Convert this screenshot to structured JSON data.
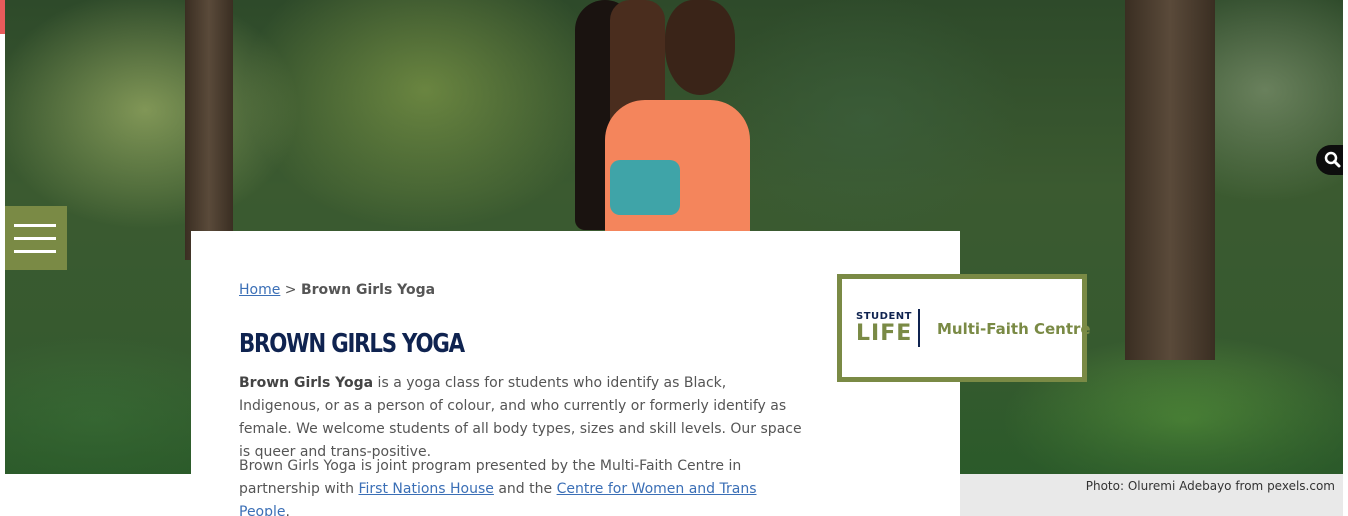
{
  "breadcrumb": {
    "home_label": "Home",
    "separator": " > ",
    "current_label": "Brown Girls Yoga"
  },
  "page": {
    "title": "BROWN GIRLS YOGA",
    "intro_bold": "Brown Girls Yoga",
    "intro_text": " is a yoga class for students who identify as Black, Indigenous, or as a person of colour, and who currently or formerly identify as female. We welcome students of all body types, sizes and skill levels. Our space is queer and trans-positive.",
    "partner_text_1": "Brown Girls Yoga is joint program presented by the Multi-Faith Centre in partnership with ",
    "partner_link_1": "First Nations House",
    "partner_text_2": " and the ",
    "partner_link_2": "Centre for Women and Trans People",
    "partner_text_3": "."
  },
  "logo": {
    "line1": "STUDENT",
    "line2": "LIFE",
    "name": "Multi-Faith Centre"
  },
  "hero": {
    "photo_credit": "Photo: Oluremi Adebayo from pexels.com"
  },
  "icons": {
    "menu": "hamburger-menu-icon",
    "search": "search-icon"
  },
  "colors": {
    "accent_olive": "#7a8a45",
    "title_navy": "#0f2350",
    "link_blue": "#3b6fb6",
    "body_text": "#555555",
    "top_left_red": "#e85b5b"
  }
}
